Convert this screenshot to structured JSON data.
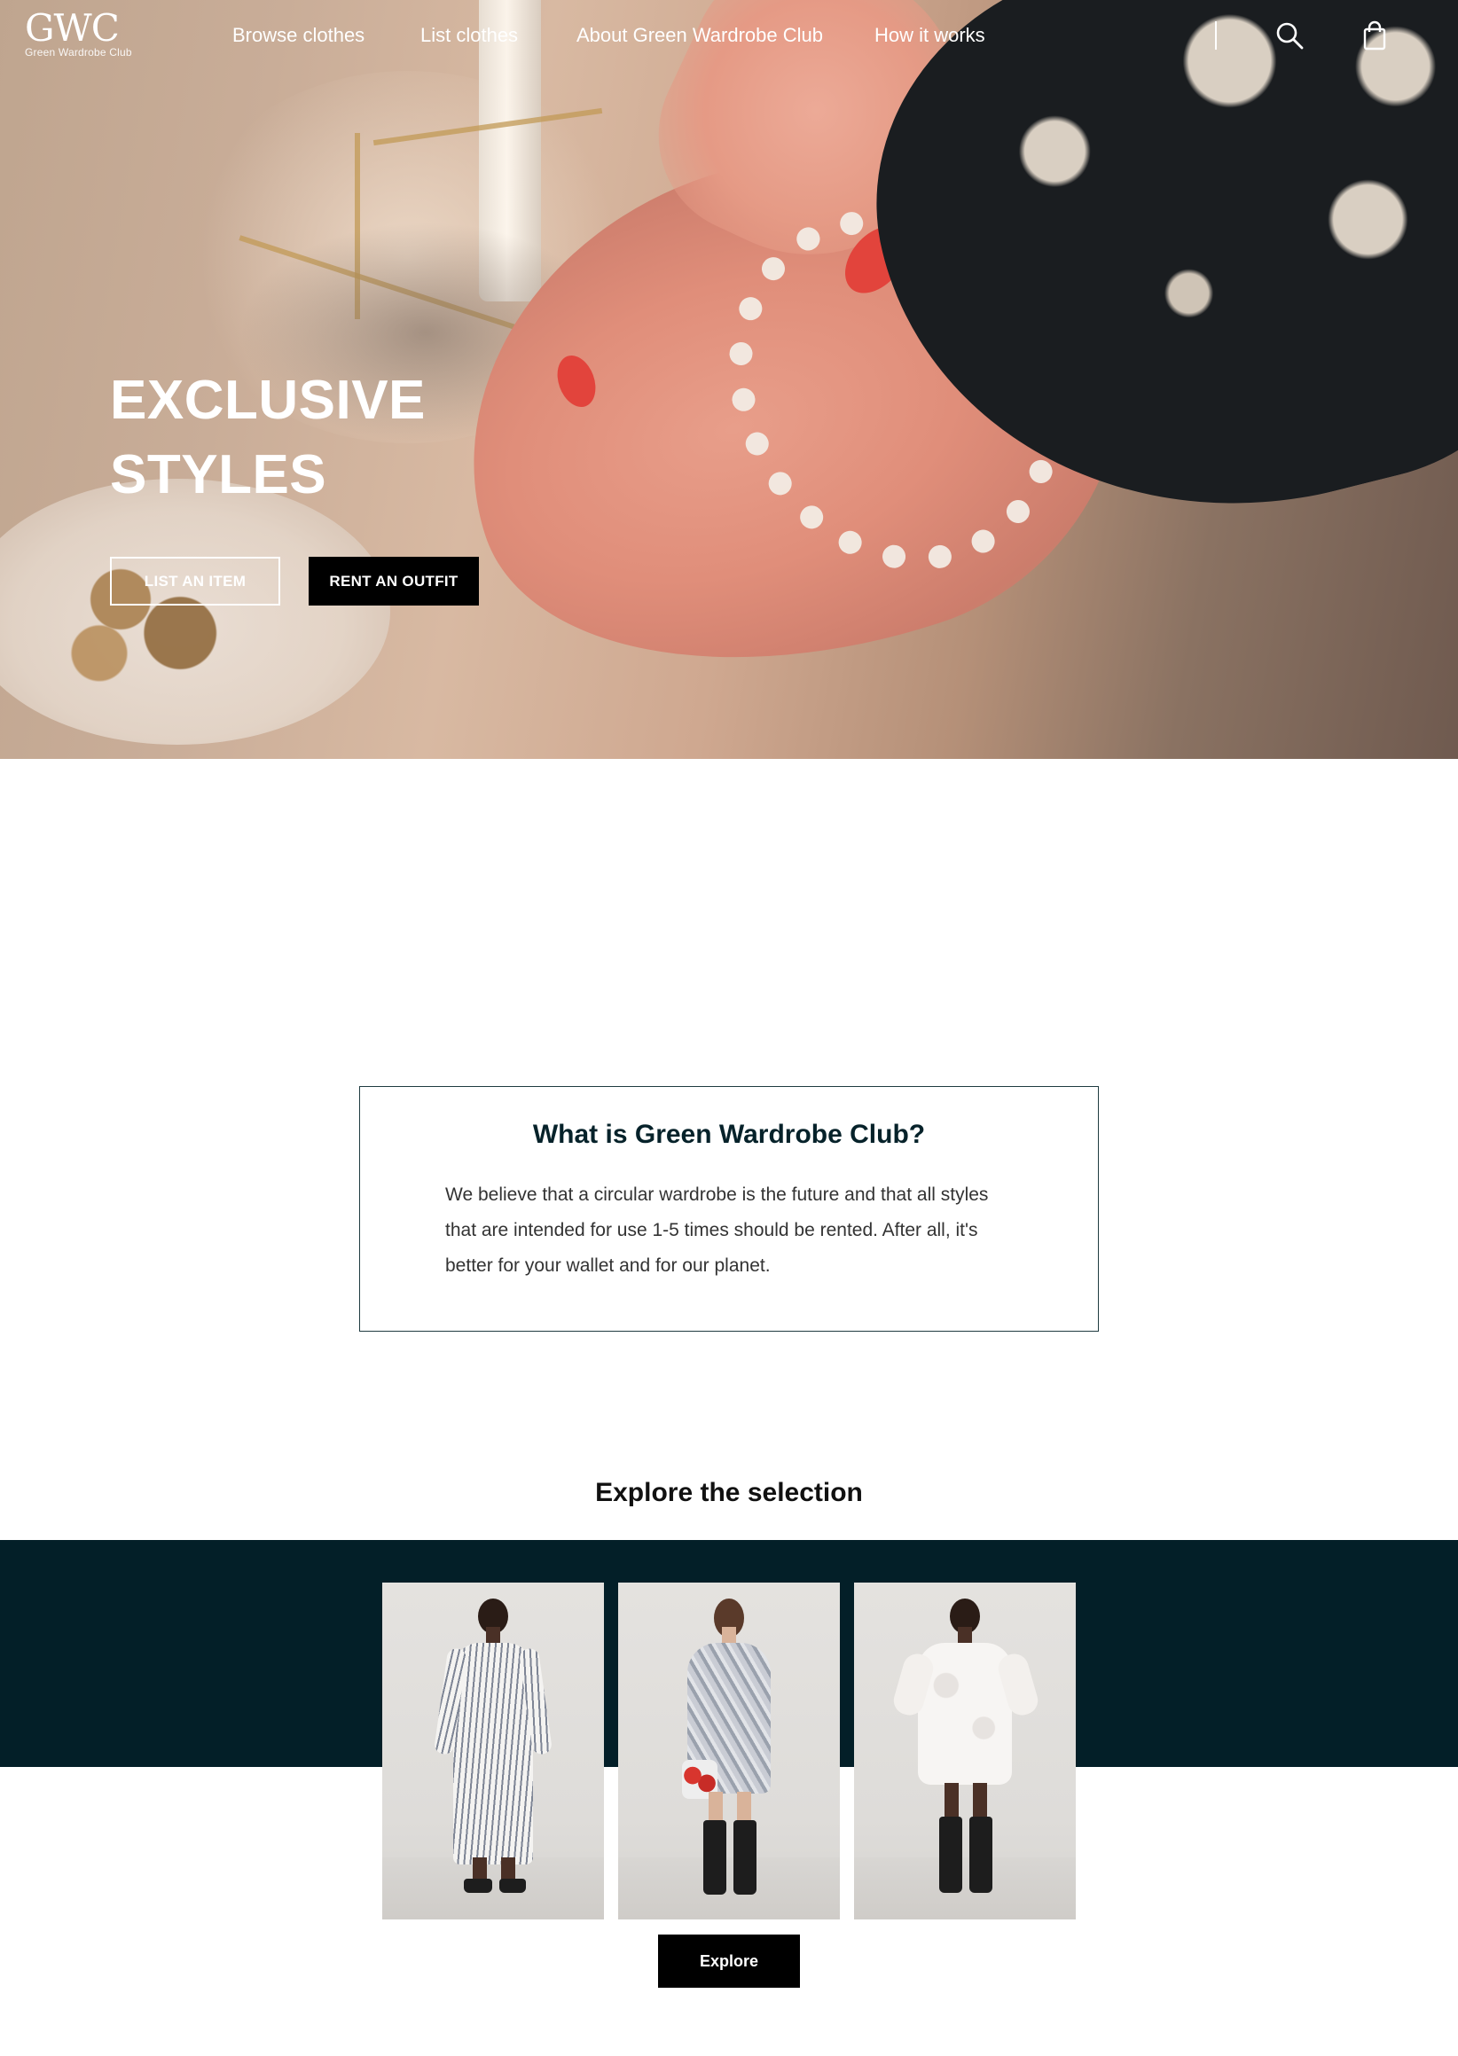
{
  "brand": {
    "logo_mark": "GWC",
    "logo_sub": "Green Wardrobe Club"
  },
  "nav": {
    "items": [
      {
        "label": "Browse clothes"
      },
      {
        "label": "List clothes"
      },
      {
        "label": "About Green Wardrobe Club"
      },
      {
        "label": "How it works"
      }
    ],
    "icons": [
      "search-icon",
      "shopping-bag-icon"
    ]
  },
  "hero": {
    "title_line1": "EXCLUSIVE",
    "title_line2": "STYLES",
    "primary_button": "LIST AN ITEM",
    "secondary_button": "RENT AN OUTFIT"
  },
  "about": {
    "heading": "What is Green Wardrobe Club?",
    "body": "We believe that a circular wardrobe is the future and that all styles that are intended for use 1-5 times should be rented. After all, it's better for your wallet and for our planet."
  },
  "selection": {
    "heading": "Explore the selection",
    "button": "Explore",
    "products": [
      {
        "name": "striped-long-dress"
      },
      {
        "name": "silver-sequin-mini-dress"
      },
      {
        "name": "white-jacquard-mini-dress"
      }
    ]
  },
  "colors": {
    "band": "#031f28",
    "heading_dark": "#06222a",
    "button_dark": "#000000"
  }
}
